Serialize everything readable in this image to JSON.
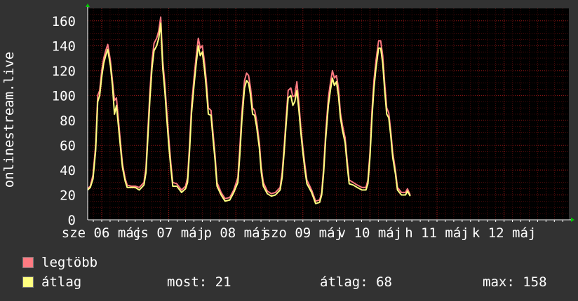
{
  "chart_data": {
    "type": "line",
    "ylabel": "onlinestream.live",
    "ylim": [
      0,
      170
    ],
    "yticks": [
      0,
      20,
      40,
      60,
      80,
      100,
      120,
      140,
      160
    ],
    "xlim": [
      0,
      7
    ],
    "grid": true,
    "x_tick_labels": [
      {
        "x": 0,
        "label": "sze 06 máj"
      },
      {
        "x": 1,
        "label": "cs 07 máj"
      },
      {
        "x": 2,
        "label": "p 08 máj"
      },
      {
        "x": 3,
        "label": "szo 09 máj"
      },
      {
        "x": 4,
        "label": "v 10 máj"
      },
      {
        "x": 5,
        "label": "h 11 máj"
      },
      {
        "x": 6,
        "label": "k 12 máj"
      }
    ],
    "series": [
      {
        "name": "legtöbb",
        "color": "#ff7b82",
        "points": [
          [
            -0.21,
            25
          ],
          [
            -0.17,
            27
          ],
          [
            -0.13,
            36
          ],
          [
            -0.09,
            60
          ],
          [
            -0.06,
            100
          ],
          [
            -0.03,
            104
          ],
          [
            0.0,
            120
          ],
          [
            0.03,
            130
          ],
          [
            0.06,
            136
          ],
          [
            0.09,
            141
          ],
          [
            0.13,
            128
          ],
          [
            0.16,
            112
          ],
          [
            0.19,
            96
          ],
          [
            0.22,
            98
          ],
          [
            0.25,
            80
          ],
          [
            0.28,
            62
          ],
          [
            0.31,
            45
          ],
          [
            0.35,
            33
          ],
          [
            0.38,
            28
          ],
          [
            0.44,
            27
          ],
          [
            0.5,
            27
          ],
          [
            0.56,
            26
          ],
          [
            0.63,
            30
          ],
          [
            0.66,
            42
          ],
          [
            0.69,
            74
          ],
          [
            0.72,
            104
          ],
          [
            0.75,
            128
          ],
          [
            0.78,
            142
          ],
          [
            0.82,
            146
          ],
          [
            0.85,
            152
          ],
          [
            0.88,
            163
          ],
          [
            0.91,
            128
          ],
          [
            0.94,
            110
          ],
          [
            0.97,
            88
          ],
          [
            1.0,
            66
          ],
          [
            1.03,
            46
          ],
          [
            1.06,
            30
          ],
          [
            1.12,
            29
          ],
          [
            1.19,
            24
          ],
          [
            1.25,
            27
          ],
          [
            1.28,
            34
          ],
          [
            1.31,
            60
          ],
          [
            1.34,
            92
          ],
          [
            1.38,
            116
          ],
          [
            1.41,
            132
          ],
          [
            1.44,
            146
          ],
          [
            1.47,
            138
          ],
          [
            1.5,
            140
          ],
          [
            1.53,
            128
          ],
          [
            1.56,
            112
          ],
          [
            1.59,
            90
          ],
          [
            1.63,
            88
          ],
          [
            1.66,
            70
          ],
          [
            1.69,
            52
          ],
          [
            1.72,
            30
          ],
          [
            1.78,
            22
          ],
          [
            1.84,
            17
          ],
          [
            1.91,
            18
          ],
          [
            1.97,
            24
          ],
          [
            2.03,
            34
          ],
          [
            2.06,
            58
          ],
          [
            2.09,
            86
          ],
          [
            2.13,
            112
          ],
          [
            2.16,
            118
          ],
          [
            2.19,
            116
          ],
          [
            2.22,
            106
          ],
          [
            2.25,
            90
          ],
          [
            2.28,
            88
          ],
          [
            2.31,
            80
          ],
          [
            2.35,
            62
          ],
          [
            2.38,
            42
          ],
          [
            2.41,
            30
          ],
          [
            2.47,
            23
          ],
          [
            2.53,
            21
          ],
          [
            2.59,
            22
          ],
          [
            2.66,
            26
          ],
          [
            2.69,
            38
          ],
          [
            2.72,
            58
          ],
          [
            2.75,
            82
          ],
          [
            2.78,
            104
          ],
          [
            2.82,
            106
          ],
          [
            2.85,
            99
          ],
          [
            2.88,
            100
          ],
          [
            2.91,
            111
          ],
          [
            2.94,
            94
          ],
          [
            2.97,
            74
          ],
          [
            3.0,
            58
          ],
          [
            3.03,
            44
          ],
          [
            3.06,
            32
          ],
          [
            3.13,
            24
          ],
          [
            3.19,
            15
          ],
          [
            3.25,
            16
          ],
          [
            3.28,
            22
          ],
          [
            3.31,
            42
          ],
          [
            3.34,
            70
          ],
          [
            3.38,
            98
          ],
          [
            3.41,
            110
          ],
          [
            3.44,
            120
          ],
          [
            3.47,
            114
          ],
          [
            3.5,
            116
          ],
          [
            3.53,
            106
          ],
          [
            3.56,
            86
          ],
          [
            3.59,
            76
          ],
          [
            3.63,
            66
          ],
          [
            3.66,
            48
          ],
          [
            3.69,
            32
          ],
          [
            3.75,
            30
          ],
          [
            3.81,
            28
          ],
          [
            3.88,
            26
          ],
          [
            3.94,
            26
          ],
          [
            3.97,
            32
          ],
          [
            4.0,
            54
          ],
          [
            4.03,
            88
          ],
          [
            4.06,
            112
          ],
          [
            4.09,
            128
          ],
          [
            4.13,
            144
          ],
          [
            4.16,
            144
          ],
          [
            4.19,
            132
          ],
          [
            4.22,
            110
          ],
          [
            4.25,
            90
          ],
          [
            4.28,
            86
          ],
          [
            4.31,
            72
          ],
          [
            4.34,
            54
          ],
          [
            4.38,
            40
          ],
          [
            4.41,
            26
          ],
          [
            4.47,
            22
          ],
          [
            4.53,
            22
          ],
          [
            4.56,
            25
          ],
          [
            4.6,
            20
          ]
        ]
      },
      {
        "name": "átlag",
        "color": "#ffff80",
        "points": [
          [
            -0.21,
            24
          ],
          [
            -0.17,
            26
          ],
          [
            -0.13,
            33
          ],
          [
            -0.09,
            56
          ],
          [
            -0.06,
            95
          ],
          [
            -0.03,
            100
          ],
          [
            0.0,
            115
          ],
          [
            0.03,
            126
          ],
          [
            0.06,
            132
          ],
          [
            0.09,
            137
          ],
          [
            0.13,
            124
          ],
          [
            0.16,
            108
          ],
          [
            0.19,
            85
          ],
          [
            0.22,
            92
          ],
          [
            0.25,
            75
          ],
          [
            0.28,
            58
          ],
          [
            0.31,
            42
          ],
          [
            0.35,
            31
          ],
          [
            0.38,
            26
          ],
          [
            0.44,
            26
          ],
          [
            0.5,
            26
          ],
          [
            0.56,
            24
          ],
          [
            0.63,
            28
          ],
          [
            0.66,
            38
          ],
          [
            0.69,
            68
          ],
          [
            0.72,
            98
          ],
          [
            0.75,
            122
          ],
          [
            0.78,
            136
          ],
          [
            0.82,
            140
          ],
          [
            0.85,
            146
          ],
          [
            0.88,
            158
          ],
          [
            0.91,
            122
          ],
          [
            0.94,
            104
          ],
          [
            0.97,
            82
          ],
          [
            1.0,
            60
          ],
          [
            1.03,
            42
          ],
          [
            1.06,
            27
          ],
          [
            1.12,
            27
          ],
          [
            1.19,
            22
          ],
          [
            1.25,
            25
          ],
          [
            1.28,
            30
          ],
          [
            1.31,
            55
          ],
          [
            1.34,
            86
          ],
          [
            1.38,
            110
          ],
          [
            1.41,
            126
          ],
          [
            1.44,
            140
          ],
          [
            1.47,
            132
          ],
          [
            1.5,
            135
          ],
          [
            1.53,
            122
          ],
          [
            1.56,
            106
          ],
          [
            1.59,
            85
          ],
          [
            1.63,
            84
          ],
          [
            1.66,
            65
          ],
          [
            1.69,
            48
          ],
          [
            1.72,
            27
          ],
          [
            1.78,
            20
          ],
          [
            1.84,
            15
          ],
          [
            1.91,
            16
          ],
          [
            1.97,
            22
          ],
          [
            2.03,
            30
          ],
          [
            2.06,
            52
          ],
          [
            2.09,
            80
          ],
          [
            2.13,
            106
          ],
          [
            2.16,
            112
          ],
          [
            2.19,
            110
          ],
          [
            2.22,
            100
          ],
          [
            2.25,
            85
          ],
          [
            2.28,
            84
          ],
          [
            2.31,
            75
          ],
          [
            2.35,
            58
          ],
          [
            2.38,
            38
          ],
          [
            2.41,
            27
          ],
          [
            2.47,
            21
          ],
          [
            2.53,
            19
          ],
          [
            2.59,
            20
          ],
          [
            2.66,
            24
          ],
          [
            2.69,
            34
          ],
          [
            2.72,
            54
          ],
          [
            2.75,
            77
          ],
          [
            2.78,
            98
          ],
          [
            2.82,
            100
          ],
          [
            2.85,
            92
          ],
          [
            2.88,
            95
          ],
          [
            2.91,
            104
          ],
          [
            2.94,
            88
          ],
          [
            2.97,
            70
          ],
          [
            3.0,
            54
          ],
          [
            3.03,
            40
          ],
          [
            3.06,
            29
          ],
          [
            3.13,
            22
          ],
          [
            3.19,
            13
          ],
          [
            3.25,
            14
          ],
          [
            3.28,
            20
          ],
          [
            3.31,
            38
          ],
          [
            3.34,
            65
          ],
          [
            3.38,
            92
          ],
          [
            3.41,
            104
          ],
          [
            3.44,
            114
          ],
          [
            3.47,
            108
          ],
          [
            3.5,
            111
          ],
          [
            3.53,
            100
          ],
          [
            3.56,
            82
          ],
          [
            3.59,
            72
          ],
          [
            3.63,
            62
          ],
          [
            3.66,
            44
          ],
          [
            3.69,
            29
          ],
          [
            3.75,
            28
          ],
          [
            3.81,
            26
          ],
          [
            3.88,
            24
          ],
          [
            3.94,
            24
          ],
          [
            3.97,
            29
          ],
          [
            4.0,
            50
          ],
          [
            4.03,
            82
          ],
          [
            4.06,
            106
          ],
          [
            4.09,
            122
          ],
          [
            4.13,
            138
          ],
          [
            4.16,
            138
          ],
          [
            4.19,
            126
          ],
          [
            4.22,
            104
          ],
          [
            4.25,
            85
          ],
          [
            4.28,
            82
          ],
          [
            4.31,
            68
          ],
          [
            4.34,
            50
          ],
          [
            4.38,
            37
          ],
          [
            4.41,
            24
          ],
          [
            4.47,
            20
          ],
          [
            4.53,
            20
          ],
          [
            4.56,
            23
          ],
          [
            4.6,
            19
          ]
        ]
      }
    ]
  },
  "legend": {
    "series": [
      {
        "label": "legtöbb",
        "color": "#ff7b82"
      },
      {
        "label": "átlag",
        "color": "#ffff80"
      }
    ],
    "stats": {
      "most": "most: 21",
      "atlag": "átlag: 68",
      "max": "max: 158"
    }
  },
  "colors": {
    "background": "#323232",
    "plot_background": "#000000",
    "grid": "#a01818",
    "axis": "#ffffff",
    "arrows": "#00cc00"
  }
}
